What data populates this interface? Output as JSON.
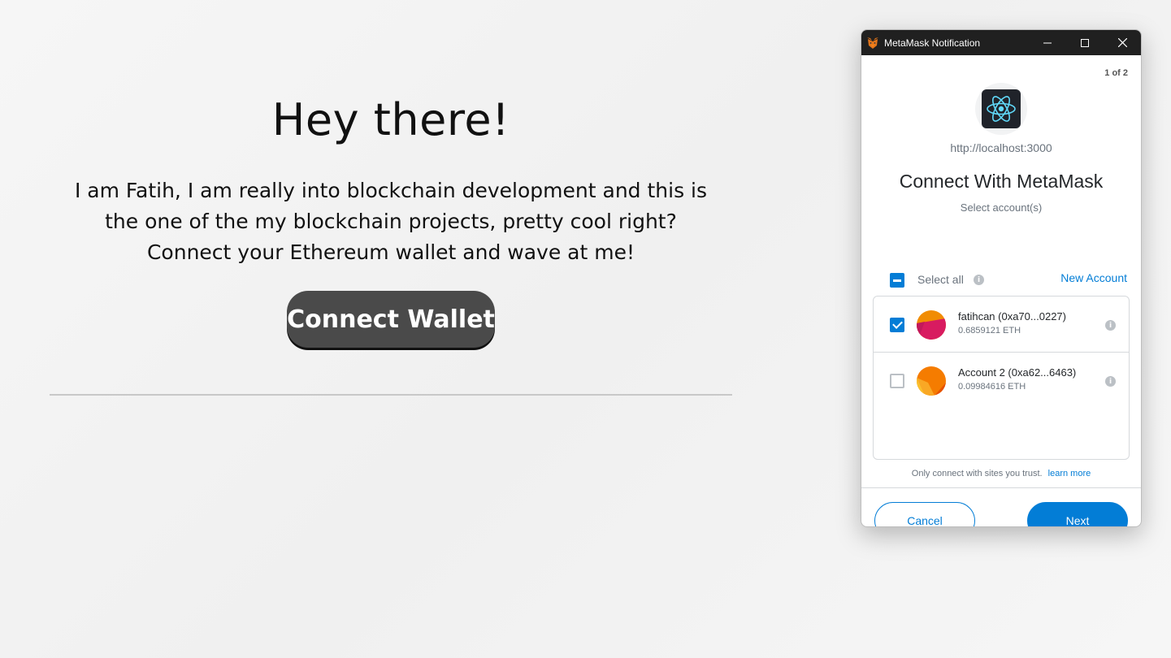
{
  "page": {
    "title": "Hey there!",
    "description_lines": [
      "I am Fatih, I am really into blockchain development and this is",
      "the one of the my blockchain projects, pretty cool right?",
      "Connect your Ethereum wallet and wave at me!"
    ],
    "connect_button": "Connect Wallet"
  },
  "metamask": {
    "window_title": "MetaMask Notification",
    "window_controls": {
      "minimize": "—",
      "maximize": "☐",
      "close": "✕"
    },
    "page_counter": "1 of 2",
    "site_url": "http://localhost:3000",
    "heading": "Connect With MetaMask",
    "subheading": "Select account(s)",
    "select_all_label": "Select all",
    "new_account_label": "New Account",
    "accounts": [
      {
        "name": "fatihcan (0xa70...0227)",
        "balance": "0.6859121 ETH",
        "checked": true
      },
      {
        "name": "Account 2 (0xa62...6463)",
        "balance": "0.09984616 ETH",
        "checked": false
      }
    ],
    "trust_text": "Only connect with sites you trust.",
    "learn_more": "learn more",
    "cancel_label": "Cancel",
    "next_label": "Next",
    "info_glyph": "i",
    "colors": {
      "accent": "#037dd6",
      "titlebar": "#202020"
    }
  }
}
